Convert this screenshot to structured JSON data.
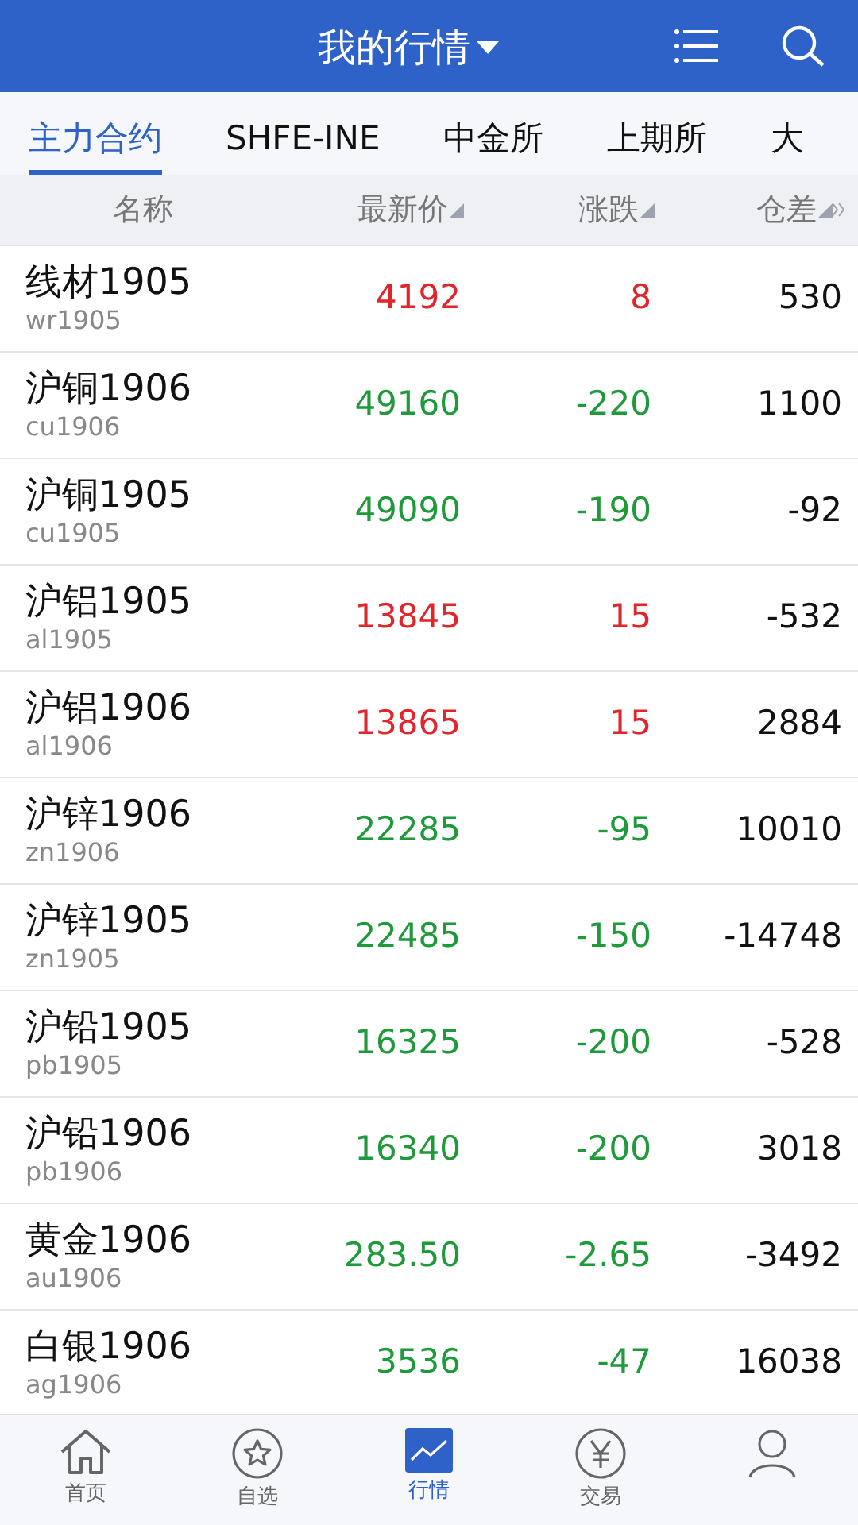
{
  "header": {
    "title": "我的行情"
  },
  "tabs": [
    {
      "label": "主力合约",
      "selected": true
    },
    {
      "label": "SHFE-INE",
      "selected": false
    },
    {
      "label": "中金所",
      "selected": false
    },
    {
      "label": "上期所",
      "selected": false
    },
    {
      "label": "大",
      "selected": false
    }
  ],
  "table": {
    "columns": [
      {
        "label": "名称",
        "sortable": false
      },
      {
        "label": "最新价",
        "sortable": true
      },
      {
        "label": "涨跌",
        "sortable": true
      },
      {
        "label": "仓差",
        "sortable": true
      }
    ],
    "rows": [
      {
        "name": "线材1905",
        "code": "wr1905",
        "color": "#e0262c",
        "price": "4192",
        "change": "8",
        "oi_change": "530"
      },
      {
        "name": "沪铜1906",
        "code": "cu1906",
        "color": "#1e9a3a",
        "price": "49160",
        "change": "-220",
        "oi_change": "1100"
      },
      {
        "name": "沪铜1905",
        "code": "cu1905",
        "color": "#1e9a3a",
        "price": "49090",
        "change": "-190",
        "oi_change": "-92"
      },
      {
        "name": "沪铝1905",
        "code": "al1905",
        "color": "#e0262c",
        "price": "13845",
        "change": "15",
        "oi_change": "-532"
      },
      {
        "name": "沪铝1906",
        "code": "al1906",
        "color": "#e0262c",
        "price": "13865",
        "change": "15",
        "oi_change": "2884"
      },
      {
        "name": "沪锌1906",
        "code": "zn1906",
        "color": "#1e9a3a",
        "price": "22285",
        "change": "-95",
        "oi_change": "10010"
      },
      {
        "name": "沪锌1905",
        "code": "zn1905",
        "color": "#1e9a3a",
        "price": "22485",
        "change": "-150",
        "oi_change": "-14748"
      },
      {
        "name": "沪铅1905",
        "code": "pb1905",
        "color": "#1e9a3a",
        "price": "16325",
        "change": "-200",
        "oi_change": "-528"
      },
      {
        "name": "沪铅1906",
        "code": "pb1906",
        "color": "#1e9a3a",
        "price": "16340",
        "change": "-200",
        "oi_change": "3018"
      },
      {
        "name": "黄金1906",
        "code": "au1906",
        "color": "#1e9a3a",
        "price": "283.50",
        "change": "-2.65",
        "oi_change": "-3492"
      },
      {
        "name": "白银1906",
        "code": "ag1906",
        "color": "#1e9a3a",
        "price": "3536",
        "change": "-47",
        "oi_change": "16038"
      }
    ]
  },
  "bottom_nav": [
    {
      "kind": "home",
      "label": "首页",
      "selected": false
    },
    {
      "kind": "star",
      "label": "自选",
      "selected": false
    },
    {
      "kind": "chart",
      "label": "行情",
      "selected": true
    },
    {
      "kind": "yen",
      "label": "交易",
      "selected": false
    },
    {
      "kind": "person",
      "selected": false
    }
  ]
}
